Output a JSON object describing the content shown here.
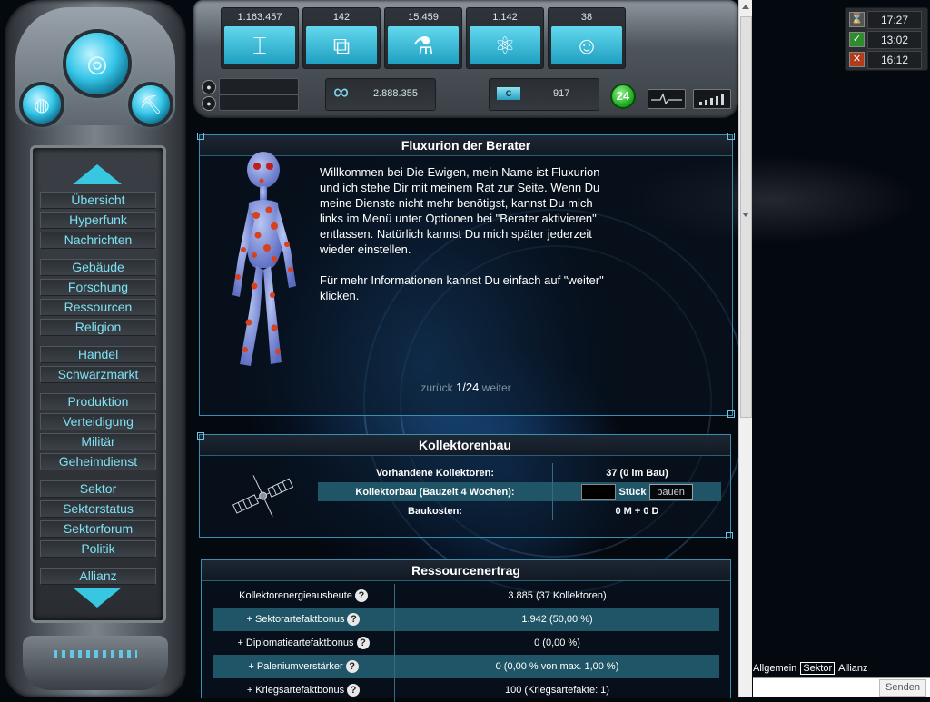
{
  "resources": [
    {
      "name": "metal",
      "value": "1.163.457",
      "icon": "girder-icon",
      "glyph": "⌶"
    },
    {
      "name": "crystal",
      "value": "142",
      "icon": "crystal-icon",
      "glyph": "⧉"
    },
    {
      "name": "chemicals",
      "value": "15.459",
      "icon": "flask-icon",
      "glyph": "⚗"
    },
    {
      "name": "energy",
      "value": "1.142",
      "icon": "atom-icon",
      "glyph": "⚛"
    },
    {
      "name": "population",
      "value": "38",
      "icon": "people-icon",
      "glyph": "☺"
    }
  ],
  "clocks": [
    {
      "icon": "hourglass-icon",
      "glyph": "⌛",
      "color": "#555555",
      "time": "17:27"
    },
    {
      "icon": "check-icon",
      "glyph": "✓",
      "color": "#2e8b2e",
      "time": "13:02"
    },
    {
      "icon": "cross-icon",
      "glyph": "✕",
      "color": "#b33a1a",
      "time": "16:12"
    }
  ],
  "info": {
    "infinity_glyph": "∞",
    "infinity_value": "2.888.355",
    "credit_label": "C",
    "credit_value": "917",
    "badge_count": "24"
  },
  "sidebar": {
    "groups": [
      [
        "Übersicht",
        "Hyperfunk",
        "Nachrichten"
      ],
      [
        "Gebäude",
        "Forschung",
        "Ressourcen",
        "Religion"
      ],
      [
        "Handel",
        "Schwarzmarkt"
      ],
      [
        "Produktion",
        "Verteidigung",
        "Militär",
        "Geheimdienst"
      ],
      [
        "Sektor",
        "Sektorstatus",
        "Sektorforum",
        "Politik"
      ],
      [
        "Allianz"
      ]
    ]
  },
  "advisor": {
    "title": "Fluxurion der Berater",
    "text1": "Willkommen bei Die Ewigen, mein Name ist Fluxurion und ich stehe Dir mit meinem Rat zur Seite. Wenn Du meine Dienste nicht mehr benötigst, kannst Du mich links im Menü unter Optionen bei \"Berater aktivieren\" entlassen. Natürlich kannst Du mich später jederzeit wieder einstellen.",
    "text2": "Für mehr Informationen kannst Du einfach auf \"weiter\" klicken.",
    "prev": "zurück",
    "page": "1/24",
    "next": "weiter"
  },
  "collector": {
    "title": "Kollektorenbau",
    "rows": [
      {
        "label": "Vorhandene Kollektoren:",
        "value": "37 (0 im Bau)"
      },
      {
        "label": "Kollektorbau (Bauzeit 4 Wochen):",
        "unit": "Stück",
        "button": "bauen"
      },
      {
        "label": "Baukosten:",
        "value": "0 M + 0 D"
      }
    ]
  },
  "yield": {
    "title": "Ressourcenertrag",
    "rows": [
      {
        "label": "Kollektorenergieausbeute",
        "value": "3.885 (37 Kollektoren)"
      },
      {
        "label": "+ Sektorartefaktbonus",
        "value": "1.942 (50,00 %)"
      },
      {
        "label": "+ Diplomatieartefaktbonus",
        "value": "0 (0,00 %)"
      },
      {
        "label": "+ Paleniumverstärker",
        "value": "0 (0,00 % von max. 1,00 %)"
      },
      {
        "label": "+ Kriegsartefaktbonus",
        "value": "100 (Kriegsartefakte: 1)"
      }
    ],
    "help_glyph": "?"
  },
  "chat": {
    "tabs": [
      "Allgemein",
      "Sektor",
      "Allianz"
    ],
    "active_tab": "Sektor",
    "send_label": "Senden"
  },
  "colors": {
    "accent": "#38c7e0",
    "menu_text": "#7ee0f2",
    "row_highlight": "#1f5566"
  }
}
